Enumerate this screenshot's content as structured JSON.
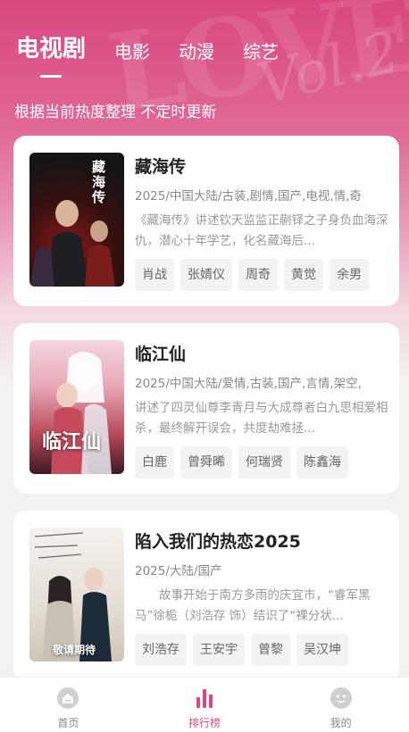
{
  "header": {
    "tabs": [
      {
        "label": "电视剧",
        "active": true
      },
      {
        "label": "电影",
        "active": false
      },
      {
        "label": "动漫",
        "active": false
      },
      {
        "label": "综艺",
        "active": false
      }
    ],
    "subtitle": "根据当前热度整理 不定时更新"
  },
  "dramas": [
    {
      "title": "藏海传",
      "meta": "2025/中国大陆/古装,剧情,国产,电视,情,奇",
      "description": "《藏海传》讲述钦天监监正蒯铎之子身负血海深仇，潜心十年学艺，化名藏海后...",
      "poster_text": "藏海传",
      "actors": [
        "肖战",
        "张婧仪",
        "周奇",
        "黄觉",
        "余男"
      ]
    },
    {
      "title": "临江仙",
      "meta": "2025/中国大陆/爱情,古装,国产,言情,架空,",
      "description": "讲述了四灵仙尊李青月与大成尊者白九思相爱相杀，最终解开误会，共度劫难拯...",
      "poster_text": "临江仙",
      "actors": [
        "白鹿",
        "曾舜晞",
        "何瑞贤",
        "陈鑫海"
      ]
    },
    {
      "title": "陷入我们的热恋2025",
      "meta": "2025/大陆/国产",
      "description": "　　故事开始于南方多雨的庆宜市，“睿军黑马”徐栀（刘浩存 饰）结识了“裸分状...",
      "poster_text": "敬请期待",
      "actors": [
        "刘浩存",
        "王安宇",
        "曾黎",
        "吴汉坤"
      ]
    }
  ],
  "nav": [
    {
      "label": "首页",
      "icon": "home-icon",
      "active": false
    },
    {
      "label": "排行榜",
      "icon": "ranking-icon",
      "active": true
    },
    {
      "label": "我的",
      "icon": "profile-icon",
      "active": false
    }
  ],
  "colors": {
    "accent": "#e0457f",
    "hero": "#d9467f"
  }
}
